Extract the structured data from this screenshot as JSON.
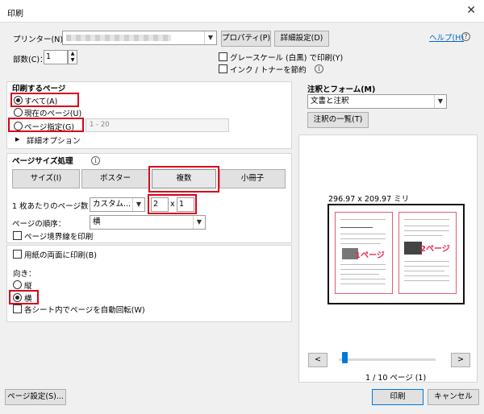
{
  "window": {
    "title": "印刷",
    "close": "✕"
  },
  "printer": {
    "label": "プリンター(N)：",
    "properties_button": "プロパティ(P)",
    "advanced_button": "詳細設定(D)",
    "help_link": "ヘルプ(H)",
    "help_icon": "?"
  },
  "copies": {
    "label": "部数(C)：",
    "value": "1"
  },
  "options": {
    "grayscale": "グレースケール (白黒) で印刷(Y)",
    "ink_save": "インク / トナーを節約",
    "info_icon": "i"
  },
  "pages_to_print": {
    "heading": "印刷するページ",
    "all": "すべて(A)",
    "current": "現在のページ(U)",
    "specify": "ページ指定(G)",
    "range_placeholder": "1 - 20",
    "more_options": "詳細オプション",
    "expand_arrow": "▶"
  },
  "page_sizing": {
    "heading": "ページサイズ処理",
    "info_icon": "i",
    "buttons": {
      "size": "サイズ(I)",
      "poster": "ポスター",
      "multiple": "複数",
      "booklet": "小冊子"
    },
    "per_sheet_label": "1 枚あたりのページ数：",
    "per_sheet_value": "カスタム...",
    "cols": "2",
    "x": "x",
    "rows": "1",
    "order_label": "ページの順序：",
    "order_value": "横",
    "print_border": "ページ境界線を印刷"
  },
  "duplex": {
    "label": "用紙の両面に印刷(B)"
  },
  "orientation": {
    "label": "向き：",
    "portrait": "縦",
    "landscape": "横",
    "auto_rotate": "各シート内でページを自動回転(W)"
  },
  "comments": {
    "heading": "注釈とフォーム(M)",
    "value": "文書と注釈",
    "summary_button": "注釈の一覧(T)"
  },
  "preview": {
    "size": "296.97 x 209.97 ミリ",
    "page1": "1ページ",
    "page2": "2ページ",
    "prev": "<",
    "next": ">",
    "page_info": "1 / 10 ページ (1)",
    "slider_position": 0.0
  },
  "footer": {
    "page_setup": "ページ設定(S)...",
    "print": "印刷",
    "cancel": "キャンセル"
  },
  "icons": {
    "chevron": "chevron-down-icon",
    "spin": "spin-icon"
  },
  "colors": {
    "highlight": "#d9001b",
    "link": "#0066cc",
    "page_border": "#e25c74",
    "accent": "#0078d7"
  }
}
